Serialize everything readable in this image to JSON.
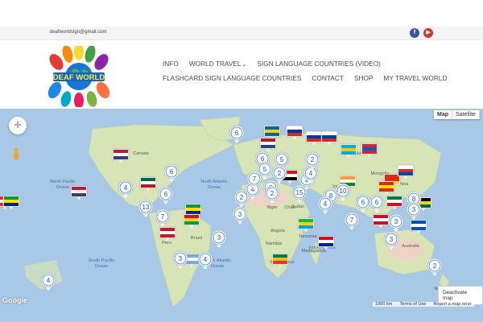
{
  "topbar": {
    "email": "deafworldsign@gmail.com"
  },
  "social": [
    {
      "name": "facebook-icon",
      "glyph": "f"
    },
    {
      "name": "youtube-icon",
      "glyph": "▶"
    }
  ],
  "logo": {
    "text": "DEAF WORLD"
  },
  "nav": {
    "row1": [
      {
        "label": "INFO"
      },
      {
        "label": "WORLD TRAVEL",
        "caret": "⌄"
      },
      {
        "label": "SIGN LANGUAGE COUNTRIES (VIDEO)"
      }
    ],
    "row2": [
      {
        "label": "FLASHCARD SIGN LANGUAGE COUNTRIES"
      },
      {
        "label": "CONTACT"
      },
      {
        "label": "SHOP"
      },
      {
        "label": "MY TRAVEL WORLD"
      }
    ]
  },
  "map": {
    "buttons": {
      "map": "Map",
      "satellite": "Satellite"
    },
    "deactivate": "Deactivate map",
    "google": "Google",
    "scale": "1000 km",
    "terms": "Terms of Use",
    "report": "Report a map error",
    "labels": [
      {
        "text": "Canada"
      },
      {
        "text": "North Pacific Ocean"
      },
      {
        "text": "North Atlantic Ocean"
      },
      {
        "text": "South Pacific Ocean"
      },
      {
        "text": "South Atlantic Ocean"
      },
      {
        "text": "Indian Ocean"
      },
      {
        "text": "Brazil"
      },
      {
        "text": "Peru"
      },
      {
        "text": "Niger"
      },
      {
        "text": "Chad"
      },
      {
        "text": "Sudan"
      },
      {
        "text": "Angola"
      },
      {
        "text": "Tanzania"
      },
      {
        "text": "Namibia"
      },
      {
        "text": "South Africa"
      },
      {
        "text": "Kazakhstan"
      },
      {
        "text": "Mongolia"
      },
      {
        "text": "China"
      },
      {
        "text": "Iran"
      },
      {
        "text": "Australia"
      },
      {
        "text": "Madagascar"
      },
      {
        "text": "New Zealand"
      }
    ],
    "clusters": [
      {
        "n": "6"
      },
      {
        "n": "6"
      },
      {
        "n": "4"
      },
      {
        "n": "6"
      },
      {
        "n": "13"
      },
      {
        "n": "7"
      },
      {
        "n": "3"
      },
      {
        "n": "3"
      },
      {
        "n": "4"
      },
      {
        "n": "2"
      },
      {
        "n": "4"
      },
      {
        "n": "2"
      },
      {
        "n": "7"
      },
      {
        "n": "6"
      },
      {
        "n": "5"
      },
      {
        "n": "2"
      },
      {
        "n": "5"
      },
      {
        "n": "2"
      },
      {
        "n": "2"
      },
      {
        "n": "4"
      },
      {
        "n": "3"
      },
      {
        "n": "15"
      },
      {
        "n": "2"
      },
      {
        "n": "10"
      },
      {
        "n": "8"
      },
      {
        "n": "6"
      },
      {
        "n": "7"
      },
      {
        "n": "6"
      },
      {
        "n": "3"
      },
      {
        "n": "8"
      },
      {
        "n": "3"
      },
      {
        "n": "3"
      },
      {
        "n": "2"
      },
      {
        "n": "4"
      },
      {
        "n": "4"
      }
    ]
  }
}
